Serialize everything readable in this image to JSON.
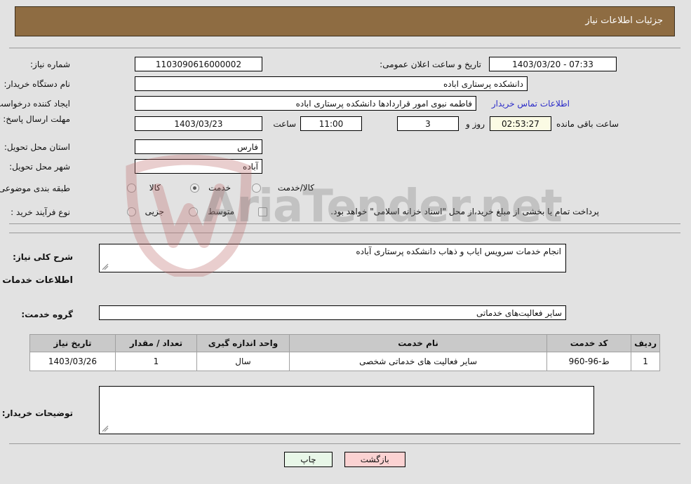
{
  "header": {
    "title": "جزئیات اطلاعات نیاز"
  },
  "fields": {
    "need_number_label": "شماره نیاز:",
    "need_number_value": "1103090616000002",
    "announce_label": "تاریخ و ساعت اعلان عمومی:",
    "announce_value": "07:33 - 1403/03/20",
    "buyer_org_label": "نام دستگاه خریدار:",
    "buyer_org_value": "دانشکده پرستاری اباده",
    "creator_label": "ایجاد کننده درخواست:",
    "creator_value": "فاطمه نبوی امور قراردادها دانشکده پرستاری اباده",
    "contact_link": "اطلاعات تماس خریدار",
    "deadline_label": "مهلت ارسال پاسخ: تا تاریخ:",
    "deadline_date": "1403/03/23",
    "hour_word": "ساعت",
    "deadline_time": "11:00",
    "days_value": "3",
    "days_word": "روز و",
    "remaining_value": "02:53:27",
    "remaining_word": "ساعت باقی مانده",
    "province_label": "استان محل تحویل:",
    "province_value": "فارس",
    "city_label": "شهر محل تحویل:",
    "city_value": "آباده",
    "category_label": "طبقه بندی موضوعی:",
    "category_options": [
      "کالا",
      "خدمت",
      "کالا/خدمت"
    ],
    "category_selected": "خدمت",
    "process_label": "نوع فرآیند خرید :",
    "process_options": [
      "جزیی",
      "متوسط"
    ],
    "process_selected": "",
    "treasury_note": "پرداخت تمام یا بخشی از مبلغ خرید،از محل \"اسناد خزانه اسلامی\" خواهد بود.",
    "treasury_checked": false
  },
  "description": {
    "label": "شرح کلی نیاز:",
    "value": "انجام خدمات سرویس ایاب و ذهاب دانشکده پرستاری آباده"
  },
  "services_section": {
    "title": "اطلاعات خدمات مورد نیاز",
    "group_label": "گروه خدمت:",
    "group_value": "سایر فعالیت‌های خدماتی"
  },
  "table": {
    "headers": [
      "ردیف",
      "کد خدمت",
      "نام خدمت",
      "واحد اندازه گیری",
      "تعداد / مقدار",
      "تاریخ نیاز"
    ],
    "rows": [
      {
        "index": "1",
        "code": "ط-96-960",
        "name": "سایر فعالیت های خدماتی شخصی",
        "unit": "سال",
        "qty": "1",
        "date": "1403/03/26"
      }
    ]
  },
  "comments": {
    "label": "توضیحات خریدار:",
    "value": ""
  },
  "footer": {
    "print_label": "چاپ",
    "back_label": "بازگشت"
  },
  "watermark": {
    "text": "AriaTender.net"
  },
  "colors": {
    "header_brown": "#8e6c42",
    "page_bg": "#e2e2e2",
    "link_blue": "#2b2bc8",
    "print_green": "#e8f7e8",
    "back_pink": "#fbd2d2",
    "countdown_cream": "#fbfbe4",
    "table_header_gray": "#c9c9c9"
  }
}
